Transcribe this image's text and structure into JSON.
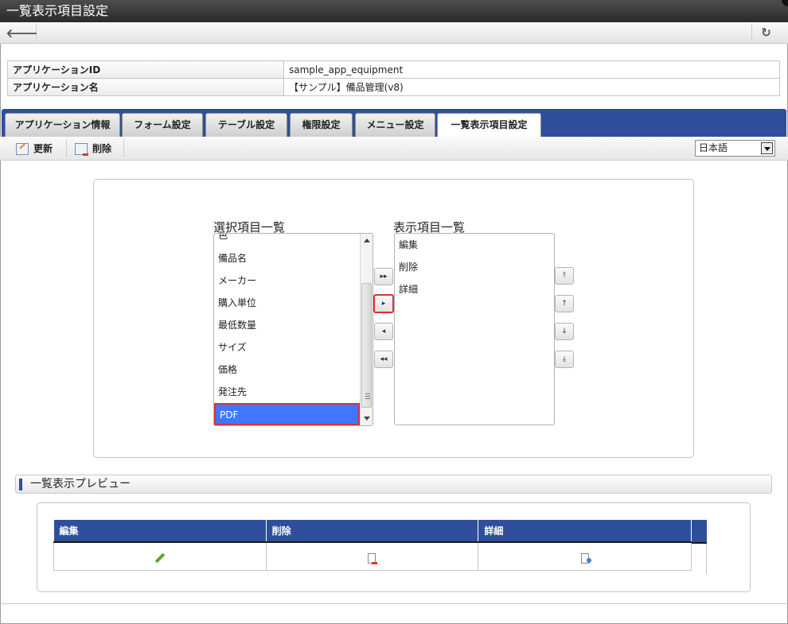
{
  "window": {
    "title": "一覧表示項目設定"
  },
  "nav": {
    "back_icon": "back-arrow-icon",
    "reload_icon": "reload-icon"
  },
  "app_info": {
    "id_label": "アプリケーションID",
    "id_value": "sample_app_equipment",
    "name_label": "アプリケーション名",
    "name_value": "【サンプル】備品管理(v8)"
  },
  "tabs": [
    {
      "label": "アプリケーション情報",
      "active": false
    },
    {
      "label": "フォーム設定",
      "active": false
    },
    {
      "label": "テーブル設定",
      "active": false
    },
    {
      "label": "権限設定",
      "active": false
    },
    {
      "label": "メニュー設定",
      "active": false
    },
    {
      "label": "一覧表示項目設定",
      "active": true
    }
  ],
  "toolbar": {
    "update_label": "更新",
    "delete_label": "削除",
    "language": "日本語"
  },
  "selector": {
    "available_title": "選択項目一覧",
    "displayed_title": "表示項目一覧",
    "available_items": [
      "色",
      "備品名",
      "メーカー",
      "購入単位",
      "最低数量",
      "サイズ",
      "価格",
      "発注先",
      "PDF"
    ],
    "selected_item": "PDF",
    "displayed_items": [
      "編集",
      "削除",
      "詳細"
    ]
  },
  "preview": {
    "section_title": "一覧表示プレビュー",
    "columns": [
      "編集",
      "削除",
      "詳細"
    ],
    "row_icons": [
      "edit-pencil-icon",
      "delete-document-icon",
      "detail-document-icon"
    ]
  },
  "colors": {
    "accent": "#2f4f9c",
    "selection": "#3f77ff",
    "highlight_border": "#d9323a"
  }
}
